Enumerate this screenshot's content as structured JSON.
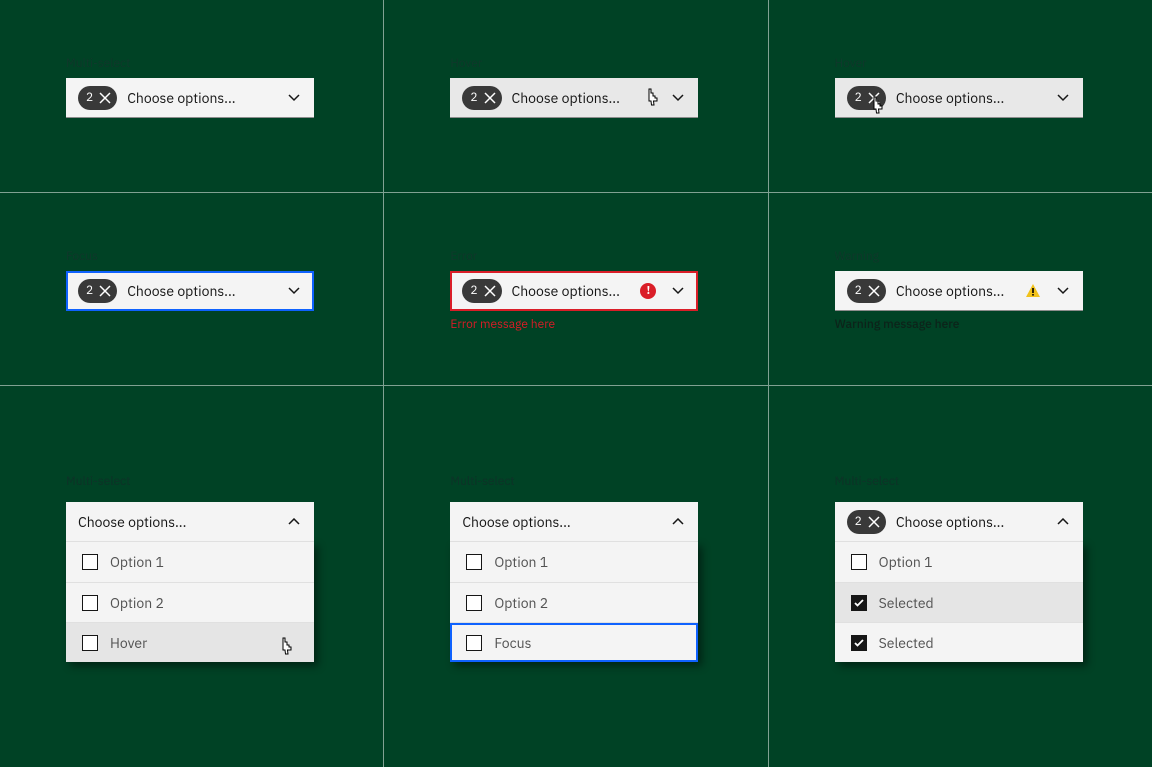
{
  "badge_count": "2",
  "placeholder": "Choose options...",
  "labels": {
    "multi_select": "Multi-select",
    "hover": "Hover",
    "focus": "Focus",
    "error": "Error",
    "warning": "Warning"
  },
  "messages": {
    "error": "Error message here",
    "warning": "Warning message here"
  },
  "menu1": {
    "opt1": "Option 1",
    "opt2": "Option 2",
    "hover": "Hover"
  },
  "menu2": {
    "opt1": "Option 1",
    "opt2": "Option 2",
    "focus": "Focus"
  },
  "menu3": {
    "opt1": "Option 1",
    "sel1": "Selected",
    "sel2": "Selected"
  }
}
